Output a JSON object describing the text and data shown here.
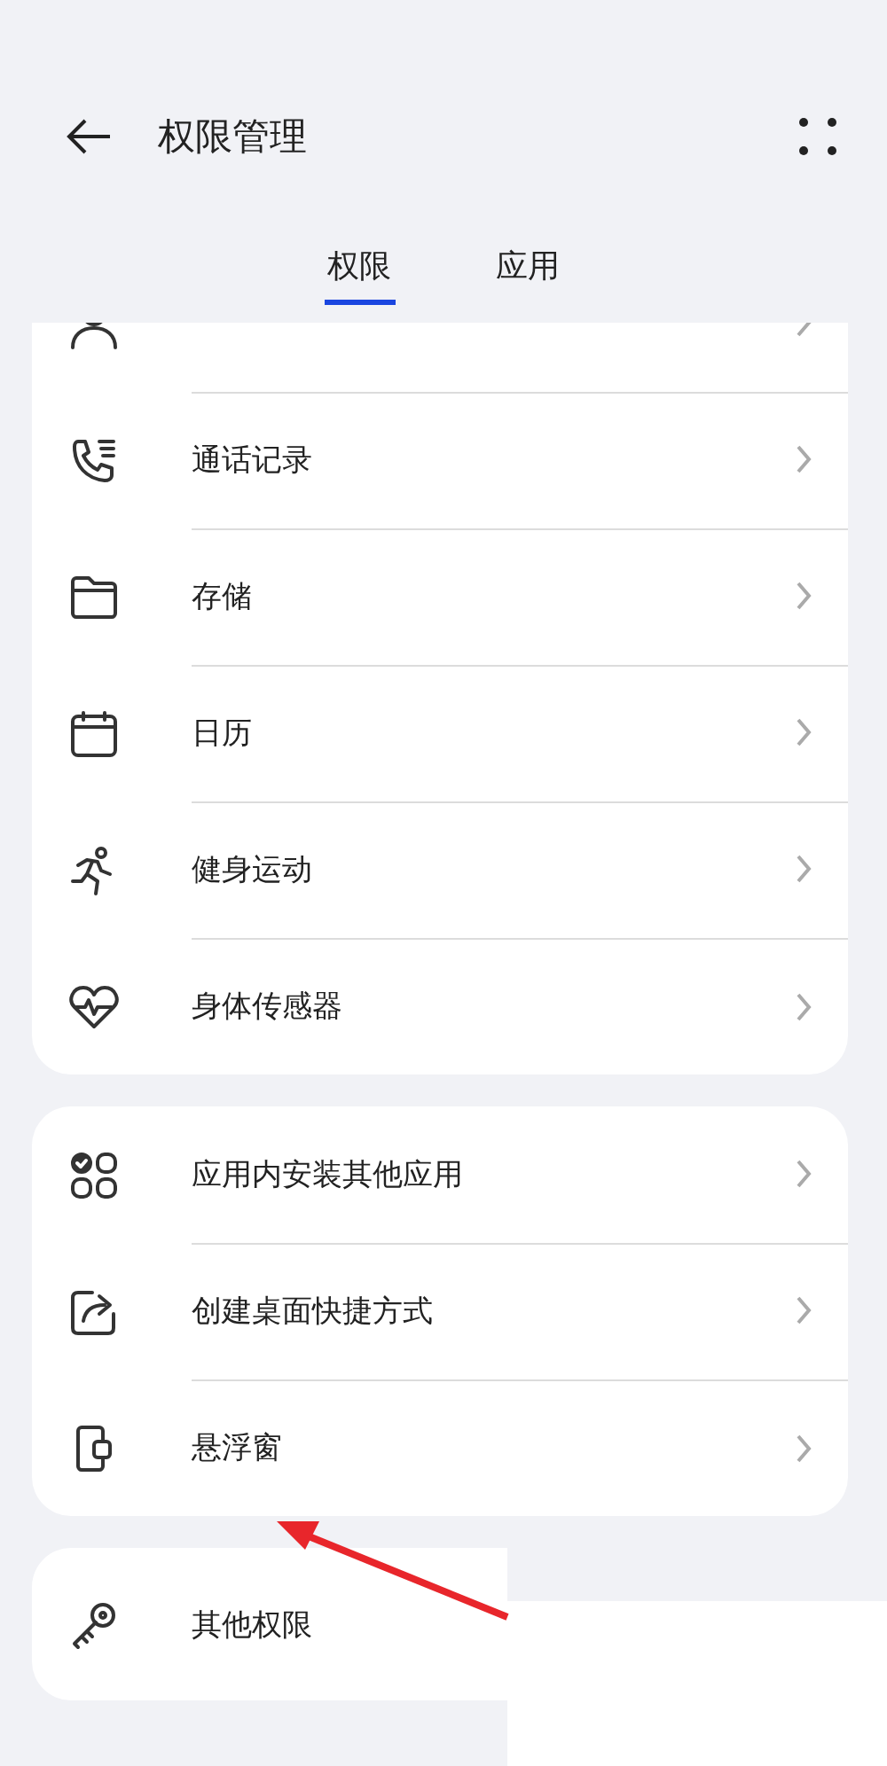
{
  "header": {
    "title": "权限管理"
  },
  "tabs": [
    {
      "label": "权限",
      "selected": true
    },
    {
      "label": "应用",
      "selected": false
    }
  ],
  "groups": [
    {
      "items": [
        {
          "kind": "contacts"
        },
        {
          "kind": "call_log",
          "label": "通话记录"
        },
        {
          "kind": "storage",
          "label": "存储"
        },
        {
          "kind": "calendar",
          "label": "日历"
        },
        {
          "kind": "fitness",
          "label": "健身运动"
        },
        {
          "kind": "sensors",
          "label": "身体传感器"
        }
      ]
    },
    {
      "items": [
        {
          "kind": "install",
          "label": "应用内安装其他应用"
        },
        {
          "kind": "shortcut",
          "label": "创建桌面快捷方式"
        },
        {
          "kind": "floating",
          "label": "悬浮窗"
        }
      ]
    },
    {
      "items": [
        {
          "kind": "other",
          "label": "其他权限"
        }
      ]
    }
  ]
}
